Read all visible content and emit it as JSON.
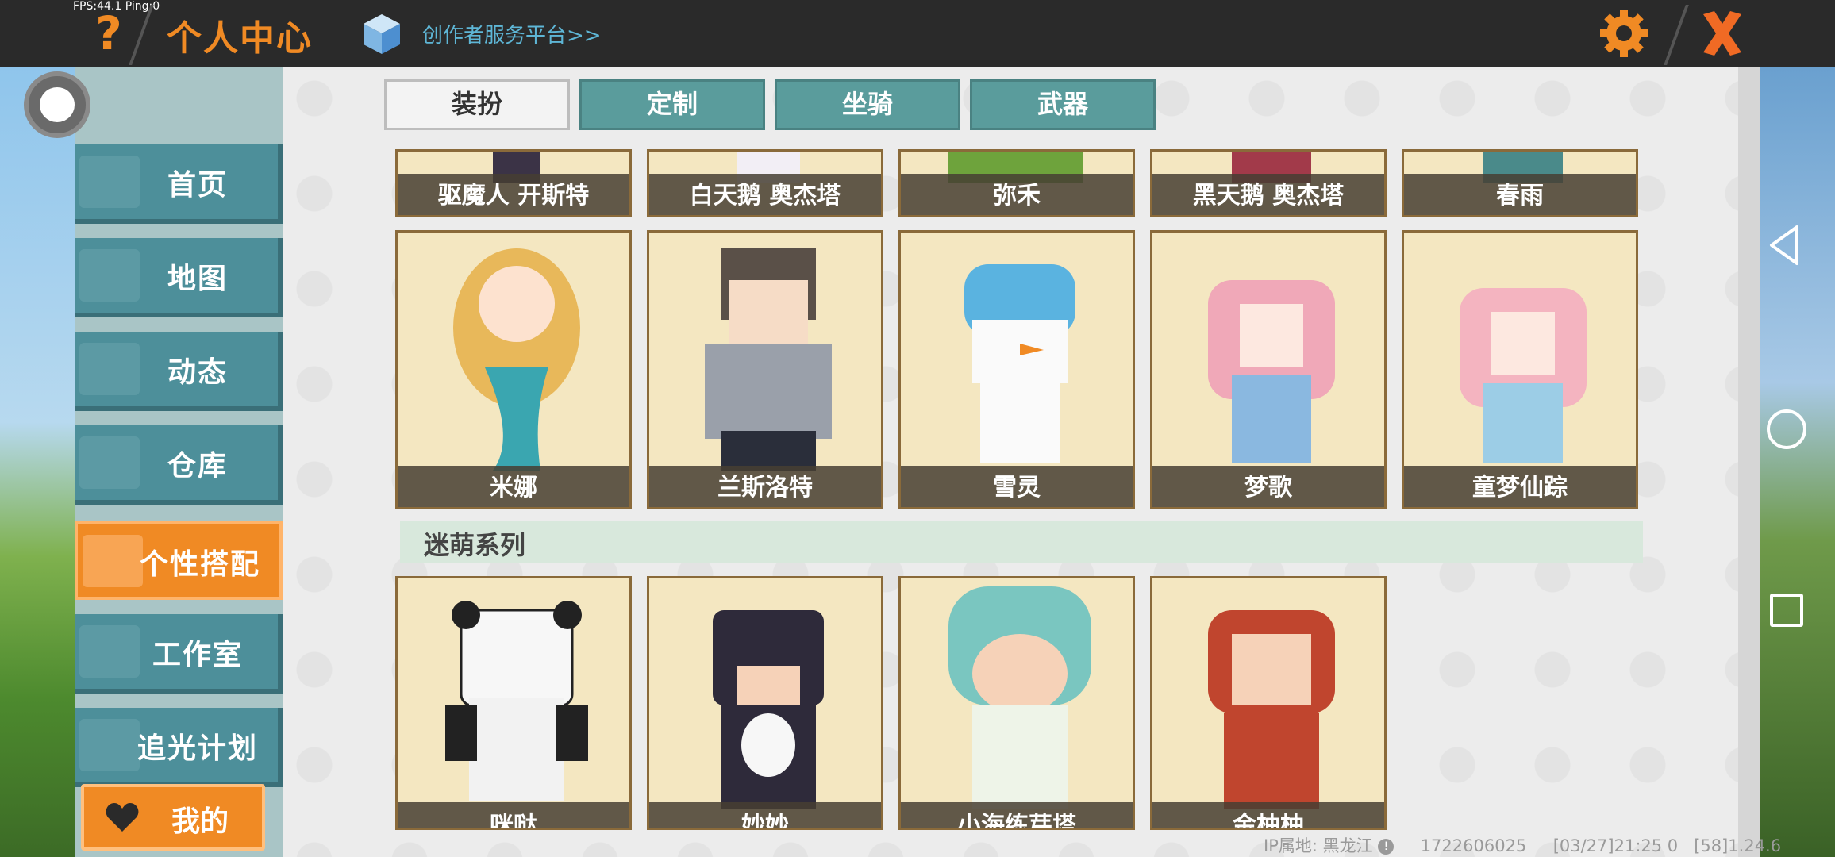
{
  "status": {
    "fps": "FPS:44.1  Ping:0"
  },
  "header": {
    "help_icon": "question-mark-icon",
    "title": "个人中心",
    "creator_link": "创作者服务平台>>",
    "settings_icon": "gear-icon",
    "close_icon": "close-icon",
    "accent_color": "#f08a24"
  },
  "sidebar": {
    "items": [
      {
        "label": "首页",
        "icon": "home-icon"
      },
      {
        "label": "地图",
        "icon": "map-icon"
      },
      {
        "label": "动态",
        "icon": "bell-icon"
      },
      {
        "label": "仓库",
        "icon": "warehouse-icon"
      },
      {
        "label": "个性搭配",
        "icon": "outfit-icon",
        "active": true
      },
      {
        "label": "工作室",
        "icon": "studio-icon"
      },
      {
        "label": "追光计划",
        "icon": "spotlight-icon"
      }
    ],
    "mine_label": "我的"
  },
  "tabs": [
    {
      "label": "装扮",
      "active": true
    },
    {
      "label": "定制"
    },
    {
      "label": "坐骑"
    },
    {
      "label": "武器"
    }
  ],
  "outfits": {
    "row_partial": [
      "驱魔人 开斯特",
      "白天鹅 奥杰塔",
      "弥禾",
      "黑天鹅 奥杰塔",
      "春雨"
    ],
    "row_full": [
      "米娜",
      "兰斯洛特",
      "雪灵",
      "梦歌",
      "童梦仙踪"
    ],
    "section_title": "迷萌系列",
    "row_bottom": [
      "咪哒",
      "妙妙",
      "小海练芽塔",
      "金柚柚"
    ]
  },
  "footer": {
    "ip_location": "IP属地: 黑龙江",
    "uid": "1722606025",
    "datetime": "[03/27]21:25 0",
    "version": "[58]1.24.6"
  }
}
